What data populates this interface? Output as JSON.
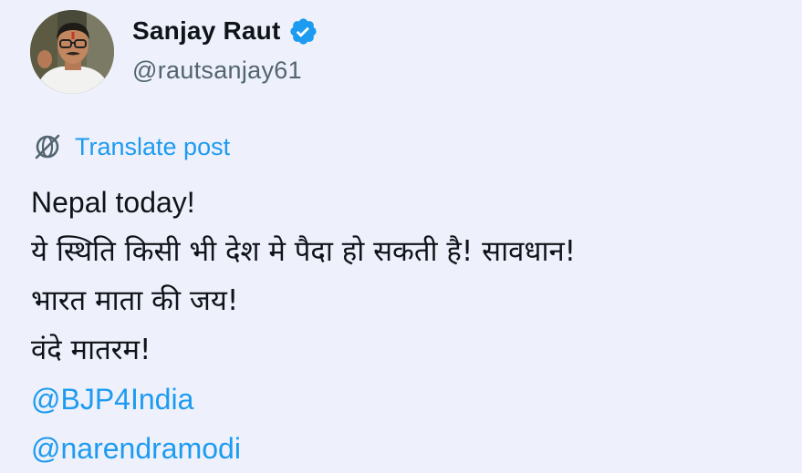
{
  "author": {
    "display_name": "Sanjay Raut",
    "handle": "@rautsanjay61",
    "avatar_icon": "profile-photo",
    "verified_icon": "verified-badge-icon",
    "verified_color": "#1d9bf0"
  },
  "translate": {
    "icon": "translate-globe-icon",
    "label": "Translate post",
    "color": "#1d9bf0"
  },
  "post": {
    "lines": [
      "Nepal today!",
      "ये स्थिति किसी भी देश मे पैदा हो सकती है! सावधान!",
      "भारत माता की जय!",
      "वंदे मातरम!"
    ],
    "mentions": [
      "@BJP4India",
      "@narendramodi"
    ],
    "mention_color": "#1d9bf0"
  }
}
